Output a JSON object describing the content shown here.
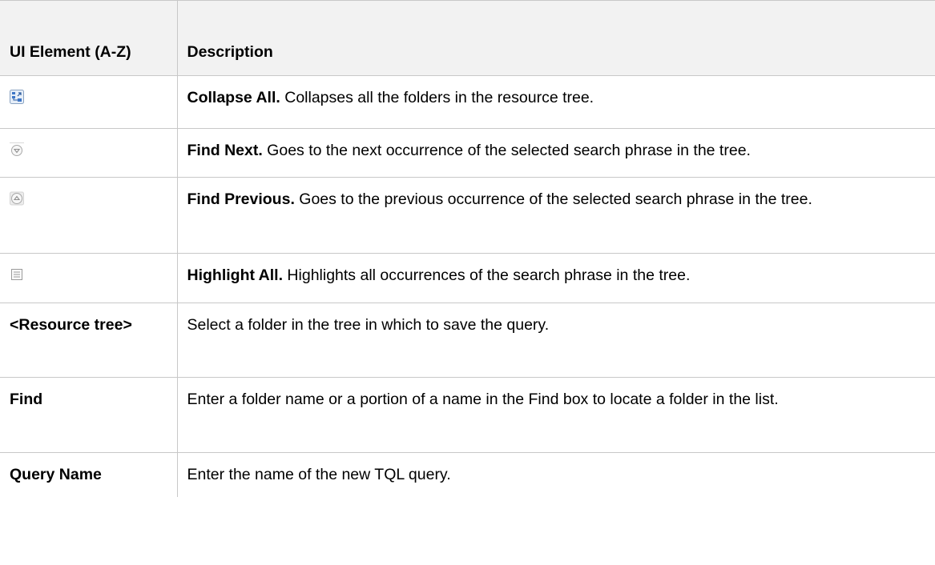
{
  "table": {
    "headers": {
      "element": "UI Element (A-Z)",
      "description": "Description"
    },
    "rows": [
      {
        "icon": "collapse-all-icon",
        "term": "Collapse All.",
        "text": " Collapses all the folders in the resource tree."
      },
      {
        "icon": "find-next-icon",
        "term": "Find Next.",
        "text": " Goes to the next occurrence of the selected search phrase in the tree."
      },
      {
        "icon": "find-previous-icon",
        "term": "Find Previous.",
        "text": " Goes to the previous occurrence of the selected search phrase in the tree."
      },
      {
        "icon": "highlight-all-icon",
        "term": "Highlight All.",
        "text": " Highlights all occurrences of the search phrase in the tree."
      },
      {
        "element": "<Resource tree>",
        "text": "Select a folder in the tree in which to save the query."
      },
      {
        "element": "Find",
        "text": "Enter a folder name or a portion of a name in the Find box to locate a folder in the list."
      },
      {
        "element": "Query Name",
        "text": "Enter the name of the new TQL query."
      }
    ]
  }
}
